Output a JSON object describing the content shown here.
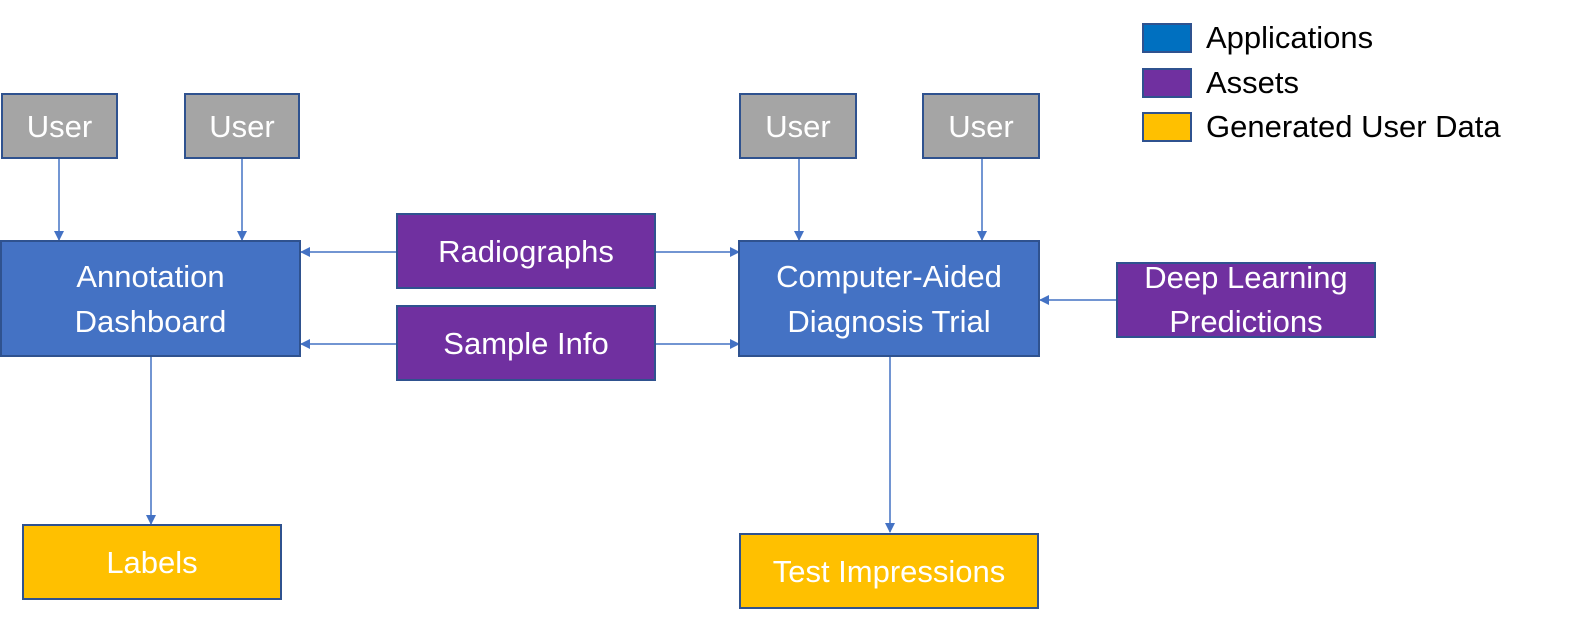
{
  "legend": [
    {
      "label": "Applications",
      "color": "#0070C0"
    },
    {
      "label": "Assets",
      "color": "#7030A0"
    },
    {
      "label": "Generated User Data",
      "color": "#FFC000"
    }
  ],
  "nodes": {
    "user1": "User",
    "user2": "User",
    "user3": "User",
    "user4": "User",
    "annotation_dashboard": [
      "Annotation",
      "Dashboard"
    ],
    "radiographs": "Radiographs",
    "sample_info": "Sample Info",
    "cad_trial": [
      "Computer-Aided",
      "Diagnosis Trial"
    ],
    "deep_learning": [
      "Deep Learning",
      "Predictions"
    ],
    "labels": "Labels",
    "test_impressions": "Test Impressions"
  },
  "edges": [
    {
      "from": "user1",
      "to": "annotation_dashboard"
    },
    {
      "from": "user2",
      "to": "annotation_dashboard"
    },
    {
      "from": "user3",
      "to": "cad_trial"
    },
    {
      "from": "user4",
      "to": "cad_trial"
    },
    {
      "from": "radiographs",
      "to": "annotation_dashboard"
    },
    {
      "from": "radiographs",
      "to": "cad_trial"
    },
    {
      "from": "sample_info",
      "to": "annotation_dashboard"
    },
    {
      "from": "sample_info",
      "to": "cad_trial"
    },
    {
      "from": "deep_learning",
      "to": "cad_trial"
    },
    {
      "from": "annotation_dashboard",
      "to": "labels"
    },
    {
      "from": "cad_trial",
      "to": "test_impressions"
    }
  ],
  "colors": {
    "user": "#A5A5A5",
    "application": "#4472C4",
    "asset": "#7030A0",
    "generated": "#FFC000",
    "border": "#2F528F",
    "edge": "#4472C4"
  }
}
